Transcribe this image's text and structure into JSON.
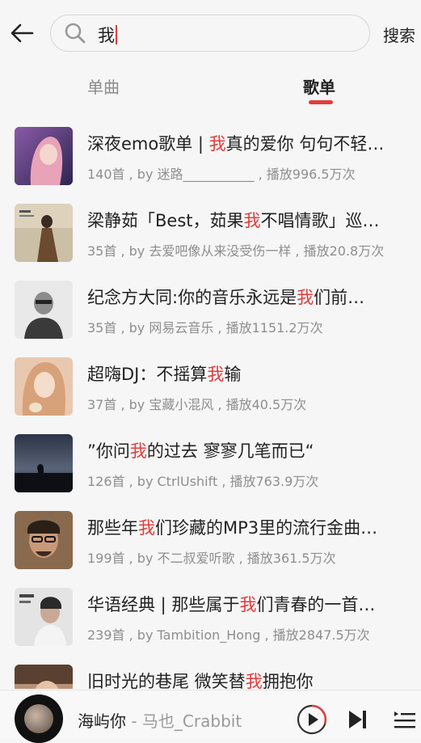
{
  "search": {
    "query": "我",
    "button_label": "搜索"
  },
  "tabs": [
    {
      "label": "单曲"
    },
    {
      "label": "歌单"
    }
  ],
  "playlists": [
    {
      "title_pre": "深夜emo歌单 | ",
      "title_hl": "我",
      "title_post": "真的爱你 句句不轻…",
      "meta": "140首 , by 迷路___________ , 播放996.5万次"
    },
    {
      "title_pre": "梁静茹「Best，茹果",
      "title_hl": "我",
      "title_post": "不唱情歌」巡…",
      "meta": "35首 , by 去爱吧像从来没受伤一样 , 播放20.8万次"
    },
    {
      "title_pre": "纪念方大同:你的音乐永远是",
      "title_hl": "我",
      "title_post": "们前…",
      "meta": "35首 , by 网易云音乐 , 播放1151.2万次"
    },
    {
      "title_pre": "超嗨DJ：不摇算",
      "title_hl": "我",
      "title_post": "输",
      "meta": "37首 , by 宝藏小混风 , 播放40.5万次"
    },
    {
      "title_pre": "”你问",
      "title_hl": "我",
      "title_post": "的过去 寥寥几笔而已“",
      "meta": "126首 , by CtrlUshift , 播放763.9万次"
    },
    {
      "title_pre": "那些年",
      "title_hl": "我",
      "title_post": "们珍藏的MP3里的流行金曲…",
      "meta": "199首 , by 不二叔爱听歌 , 播放361.5万次"
    },
    {
      "title_pre": "华语经典 | 那些属于",
      "title_hl": "我",
      "title_post": "们青春的一首…",
      "meta": "239首 , by Tambition_Hong , 播放2847.5万次"
    },
    {
      "title_pre": "旧时光的巷尾 微笑替",
      "title_hl": "我",
      "title_post": "拥抱你",
      "meta": ""
    }
  ],
  "player": {
    "song": "海屿你",
    "artist": " - 马也_Crabbit"
  },
  "colors": {
    "accent": "#e33c3c",
    "meta_text": "#8e8e8e"
  }
}
